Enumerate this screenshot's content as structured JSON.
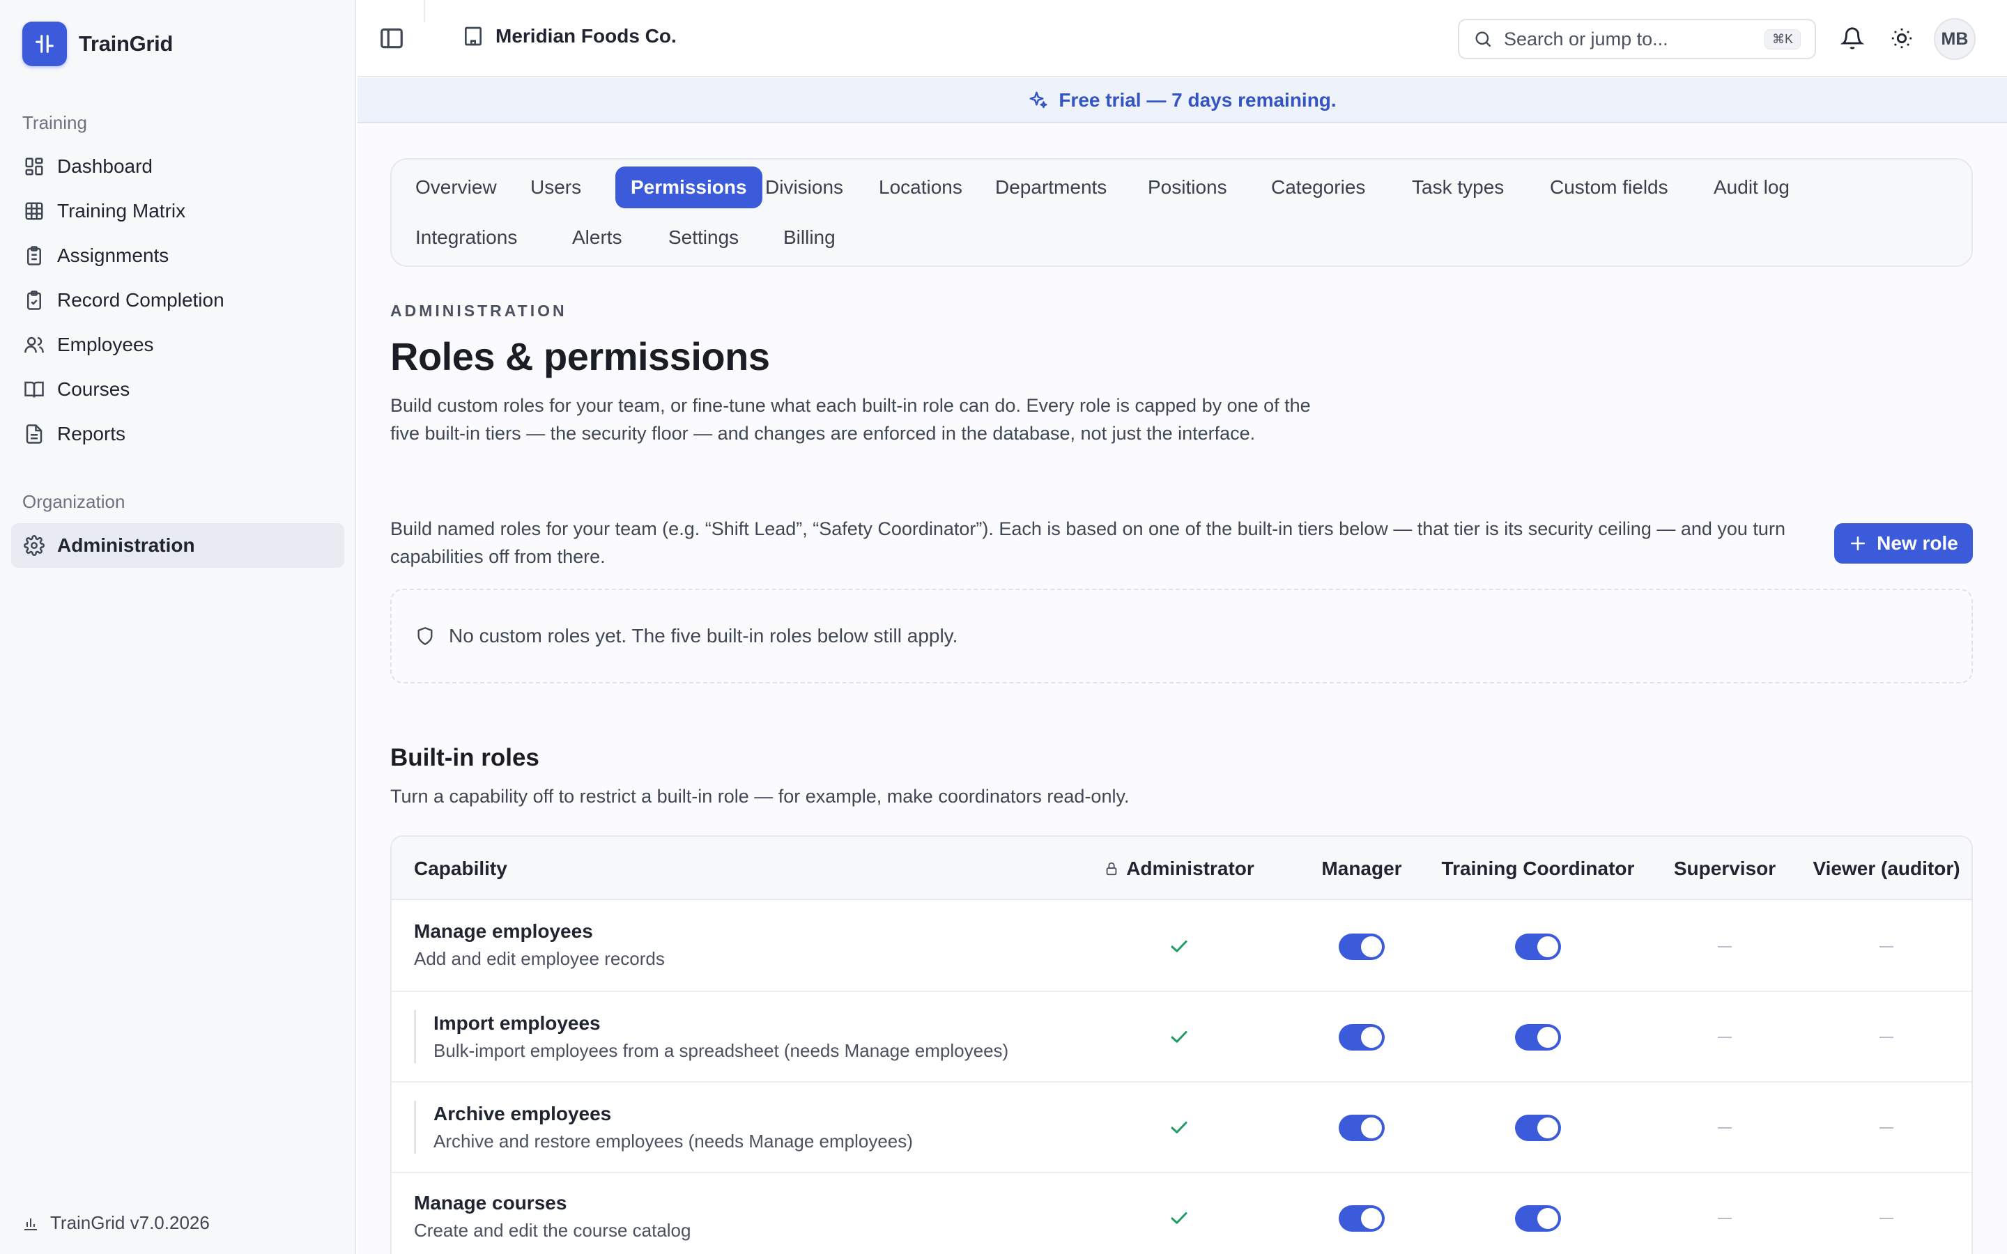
{
  "app": {
    "name": "TrainGrid",
    "version": "TrainGrid v7.0.2026"
  },
  "sidebar": {
    "section_training": "Training",
    "training_items": [
      {
        "label": "Dashboard",
        "icon": "dashboard-icon"
      },
      {
        "label": "Training Matrix",
        "icon": "grid-icon"
      },
      {
        "label": "Assignments",
        "icon": "clipboard-list-icon"
      },
      {
        "label": "Record Completion",
        "icon": "clipboard-check-icon"
      },
      {
        "label": "Employees",
        "icon": "users-icon"
      },
      {
        "label": "Courses",
        "icon": "book-icon"
      },
      {
        "label": "Reports",
        "icon": "file-text-icon"
      }
    ],
    "section_org": "Organization",
    "org_items": [
      {
        "label": "Administration",
        "icon": "gear-icon",
        "active": true
      }
    ]
  },
  "topbar": {
    "org_name": "Meridian Foods Co.",
    "search_placeholder": "Search or jump to...",
    "search_shortcut": "⌘K",
    "avatar_initials": "MB"
  },
  "banner": {
    "text": "Free trial — 7 days remaining."
  },
  "tabs": [
    {
      "label": "Overview"
    },
    {
      "label": "Users"
    },
    {
      "label": "Permissions",
      "active": true
    },
    {
      "label": "Divisions"
    },
    {
      "label": "Locations"
    },
    {
      "label": "Departments"
    },
    {
      "label": "Positions"
    },
    {
      "label": "Categories"
    },
    {
      "label": "Task types"
    },
    {
      "label": "Custom fields"
    },
    {
      "label": "Audit log"
    },
    {
      "label": "Integrations"
    },
    {
      "label": "Alerts"
    },
    {
      "label": "Settings"
    },
    {
      "label": "Billing"
    }
  ],
  "page": {
    "eyebrow": "ADMINISTRATION",
    "title": "Roles & permissions",
    "lead": "Build custom roles for your team, or fine-tune what each built-in role can do. Every role is capped by one of the five built-in tiers — the security floor — and changes are enforced in the database, not just the interface.",
    "custom_roles_description": "Build named roles for your team (e.g. “Shift Lead”, “Safety Coordinator”). Each is based on one of the built-in tiers below — that tier is its security ceiling — and you turn capabilities off from there.",
    "new_role_label": "New role",
    "empty_state": "No custom roles yet. The five built-in roles below still apply.",
    "builtin_title": "Built-in roles",
    "builtin_subtitle": "Turn a capability off to restrict a built-in role — for example, make coordinators read-only."
  },
  "table": {
    "headers": {
      "capability": "Capability",
      "administrator": "Administrator",
      "manager": "Manager",
      "coordinator": "Training Coordinator",
      "supervisor": "Supervisor",
      "viewer": "Viewer (auditor)"
    },
    "rows": [
      {
        "title": "Manage employees",
        "description": "Add and edit employee records",
        "child": false,
        "administrator": "locked-on",
        "manager": "on",
        "coordinator": "on",
        "supervisor": "n/a",
        "viewer": "n/a"
      },
      {
        "title": "Import employees",
        "description": "Bulk-import employees from a spreadsheet (needs Manage employees)",
        "child": true,
        "administrator": "locked-on",
        "manager": "on",
        "coordinator": "on",
        "supervisor": "n/a",
        "viewer": "n/a"
      },
      {
        "title": "Archive employees",
        "description": "Archive and restore employees (needs Manage employees)",
        "child": true,
        "administrator": "locked-on",
        "manager": "on",
        "coordinator": "on",
        "supervisor": "n/a",
        "viewer": "n/a"
      },
      {
        "title": "Manage courses",
        "description": "Create and edit the course catalog",
        "child": false,
        "administrator": "locked-on",
        "manager": "on",
        "coordinator": "on",
        "supervisor": "n/a",
        "viewer": "n/a"
      }
    ]
  },
  "colors": {
    "accent": "#3b5bdb",
    "check": "#1f9d63",
    "banner_text": "#3454c4"
  }
}
